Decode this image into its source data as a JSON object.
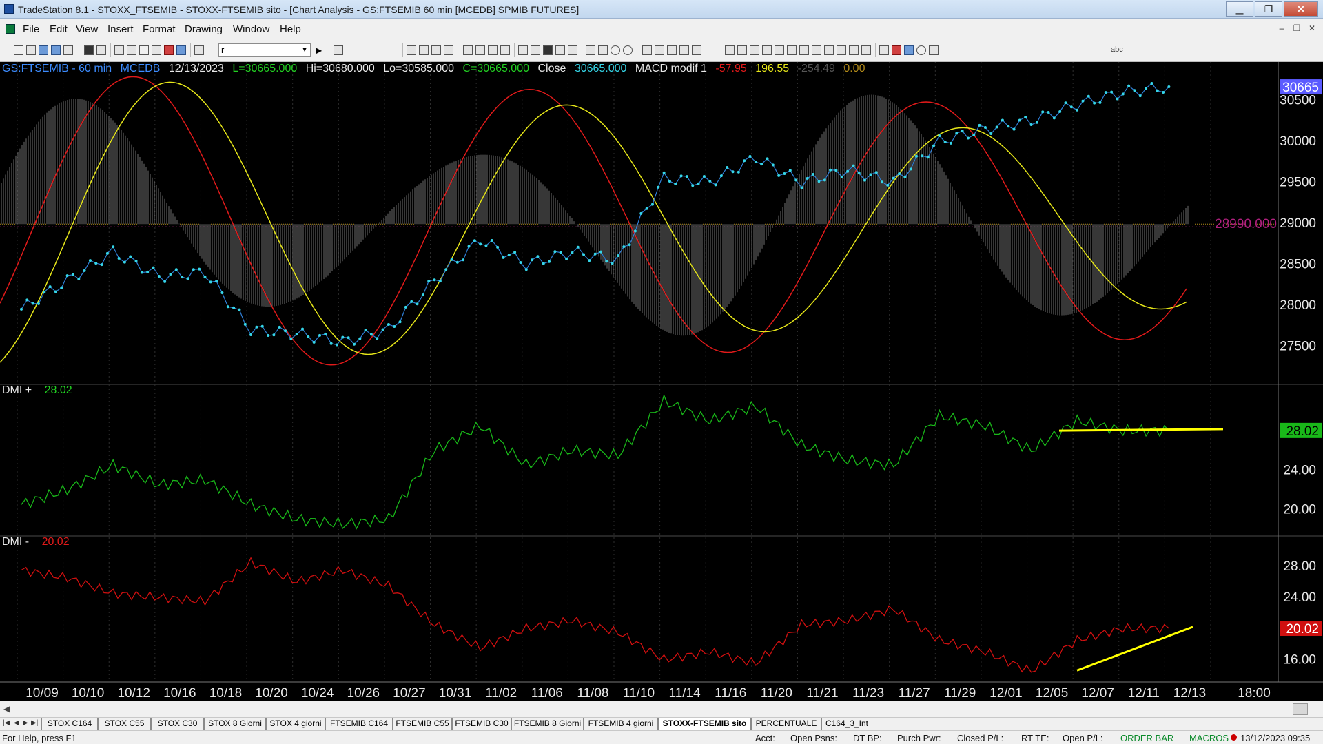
{
  "window": {
    "title": "TradeStation 8.1 - STOXX_FTSEMIB - STOXX-FTSEMIB sito - [Chart Analysis - GS:FTSEMIB  60 min  [MCEDB] SPMIB FUTURES]",
    "minimize": "▁",
    "restore": "❐",
    "close": "✕"
  },
  "menu": {
    "items": [
      "File",
      "Edit",
      "View",
      "Insert",
      "Format",
      "Drawing",
      "Window",
      "Help"
    ],
    "mdi_minimize": "–",
    "mdi_restore": "❐",
    "mdi_close": "✕"
  },
  "toolbar": {
    "symbol_value": "r",
    "drawing_text_label": "abc"
  },
  "chart": {
    "header": {
      "symbol": "GS:FTSEMIB - 60 min",
      "session": "MCEDB",
      "date": "12/13/2023",
      "last": "L=30665.000",
      "high": "Hi=30680.000",
      "low": "Lo=30585.000",
      "close_eq": "C=30665.000",
      "close_label": "Close",
      "close_value": "30665.000",
      "indicator": "MACD modif 1",
      "ind_v1": "-57.95",
      "ind_v2": "196.55",
      "ind_v3": "-254.49",
      "ind_v4": "0.00"
    },
    "colors": {
      "price": "#35d6e8",
      "macd_line": "#e21a1a",
      "signal_line": "#e6e619",
      "histogram": "#6e6e6e",
      "dmi_plus": "#19b819",
      "dmi_minus": "#d01010",
      "trendline": "#ffff00",
      "zero_line": "#b28a19",
      "level_marker": "#b0207e",
      "last_price_box": "#5b5bff"
    },
    "last_price_label": "30665",
    "level_label": "28990.000",
    "price_axis": [
      "30500",
      "30000",
      "29500",
      "29000",
      "28500",
      "28000",
      "27500"
    ],
    "dmi_plus": {
      "label": "DMI +",
      "value": "28.02",
      "last_box": "28.02",
      "axis": [
        "24.00",
        "20.00"
      ]
    },
    "dmi_minus": {
      "label": "DMI -",
      "value": "20.02",
      "last_box": "20.02",
      "axis": [
        "28.00",
        "24.00",
        "16.00"
      ]
    },
    "x_axis": [
      "10/09",
      "10/10",
      "10/12",
      "10/16",
      "10/18",
      "10/20",
      "10/24",
      "10/26",
      "10/27",
      "10/31",
      "11/02",
      "11/06",
      "11/08",
      "11/10",
      "11/14",
      "11/16",
      "11/20",
      "11/21",
      "11/23",
      "11/27",
      "11/29",
      "12/01",
      "12/05",
      "12/07",
      "12/11",
      "12/13",
      "18:00"
    ]
  },
  "chart_data": {
    "type": "line",
    "x": [
      "10/09",
      "10/10",
      "10/12",
      "10/16",
      "10/18",
      "10/20",
      "10/24",
      "10/26",
      "10/27",
      "10/31",
      "11/02",
      "11/06",
      "11/08",
      "11/10",
      "11/14",
      "11/16",
      "11/20",
      "11/21",
      "11/23",
      "11/27",
      "11/29",
      "12/01",
      "12/05",
      "12/07",
      "12/11",
      "12/13"
    ],
    "series": [
      {
        "name": "GS:FTSEMIB - 60 min",
        "values": [
          27950,
          28300,
          28650,
          28350,
          28400,
          27700,
          27650,
          27550,
          27700,
          28300,
          28800,
          28500,
          28650,
          28550,
          29550,
          29500,
          29800,
          29500,
          29650,
          29500,
          30000,
          30150,
          30250,
          30450,
          30600,
          30665
        ]
      },
      {
        "name": "DMI +",
        "values": [
          20.5,
          22.0,
          24.5,
          22.5,
          23.0,
          20.5,
          19.0,
          18.5,
          19.0,
          26.0,
          28.5,
          24.5,
          26.0,
          25.5,
          31.0,
          29.0,
          30.5,
          26.5,
          25.0,
          24.5,
          29.5,
          28.5,
          26.0,
          29.0,
          28.0,
          28.02
        ]
      },
      {
        "name": "DMI -",
        "values": [
          27.5,
          26.5,
          24.5,
          24.0,
          23.5,
          28.5,
          26.0,
          27.5,
          25.5,
          20.5,
          17.5,
          20.0,
          21.0,
          19.5,
          16.0,
          17.0,
          15.5,
          20.5,
          21.0,
          22.5,
          18.5,
          17.0,
          14.5,
          18.5,
          20.0,
          20.02
        ]
      }
    ],
    "ylim_price": [
      27200,
      30800
    ],
    "ylim_dmi_plus": [
      18,
      32
    ],
    "ylim_dmi_minus": [
      14,
      31
    ],
    "grid": false,
    "legend": "top-left"
  }
}
